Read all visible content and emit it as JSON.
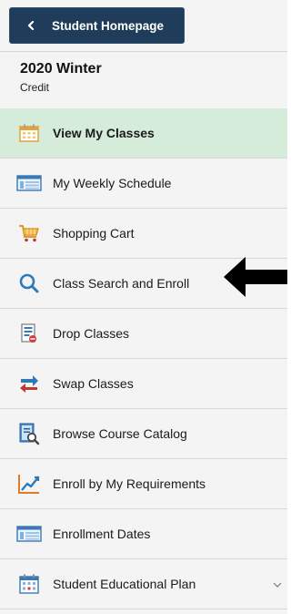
{
  "header": {
    "back_label": "Student Homepage"
  },
  "term": {
    "title": "2020 Winter",
    "subtitle": "Credit"
  },
  "menu": {
    "items": [
      {
        "label": "View My Classes",
        "icon": "calendar-icon"
      },
      {
        "label": "My Weekly Schedule",
        "icon": "schedule-icon"
      },
      {
        "label": "Shopping Cart",
        "icon": "shopping-cart-icon"
      },
      {
        "label": "Class Search and Enroll",
        "icon": "search-icon"
      },
      {
        "label": "Drop Classes",
        "icon": "drop-icon"
      },
      {
        "label": "Swap Classes",
        "icon": "swap-icon"
      },
      {
        "label": "Browse Course Catalog",
        "icon": "catalog-icon"
      },
      {
        "label": "Enroll by My Requirements",
        "icon": "chart-icon"
      },
      {
        "label": "Enrollment Dates",
        "icon": "schedule-icon"
      },
      {
        "label": "Student Educational Plan",
        "icon": "calendar-icon"
      }
    ],
    "active_index": 0
  },
  "colors": {
    "header_bg": "#1f3d5a",
    "active_bg": "#d6ecdb"
  }
}
